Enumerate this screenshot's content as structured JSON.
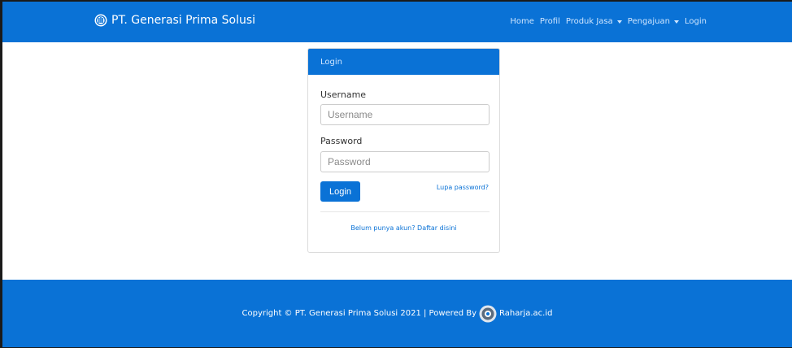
{
  "navbar": {
    "brand": "PT. Generasi Prima Solusi",
    "brand_icon": "company-logo-icon",
    "items": [
      {
        "label": "Home",
        "has_dropdown": false
      },
      {
        "label": "Profil",
        "has_dropdown": false
      },
      {
        "label": "Produk Jasa",
        "has_dropdown": true
      },
      {
        "label": "Pengajuan",
        "has_dropdown": true
      },
      {
        "label": "Login",
        "has_dropdown": false
      }
    ]
  },
  "login_panel": {
    "heading": "Login",
    "username_label": "Username",
    "username_placeholder": "Username",
    "username_value": "",
    "password_label": "Password",
    "password_placeholder": "Password",
    "password_value": "",
    "submit_label": "Login",
    "forgot_link": "Lupa password?",
    "register_link": "Belum punya akun? Daftar disini"
  },
  "footer": {
    "copyright": "Copyright © PT. Generasi Prima Solusi 2021 | Powered By",
    "powered_logo_icon": "raharja-logo-icon",
    "powered_name": "Raharja.ac.id"
  },
  "colors": {
    "primary": "#0a72d6",
    "nav_text": "#cfe6ff",
    "frame_border": "#1a1a1a"
  }
}
